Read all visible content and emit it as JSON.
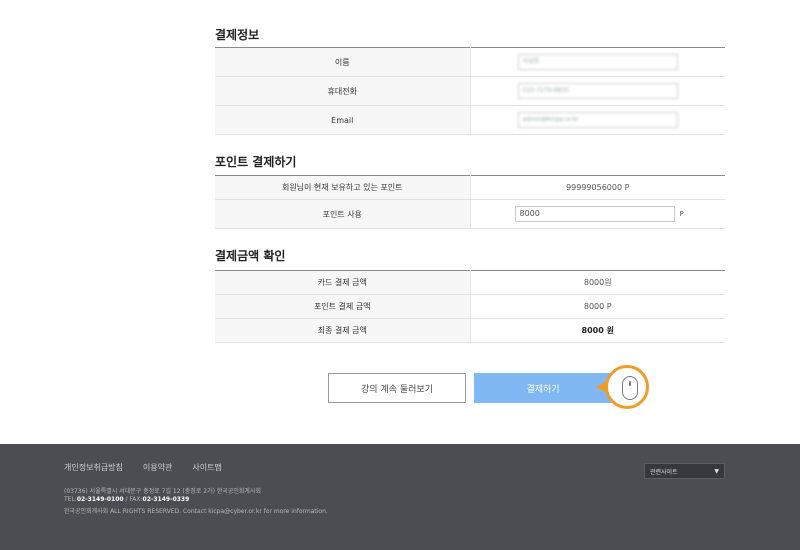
{
  "payment_info": {
    "title": "결제정보",
    "rows": [
      {
        "label": "이름",
        "value": "이성현"
      },
      {
        "label": "휴대전화",
        "value": "010-7270-9835"
      },
      {
        "label": "Email",
        "value": "admin@kicpa.or.kr"
      }
    ]
  },
  "point_payment": {
    "title": "포인트 결제하기",
    "owned_label": "회원님이 현재 보유하고 있는 포인트",
    "owned_value": "99999056000 P",
    "use_label": "포인트 사용",
    "use_value": "8000",
    "use_unit": "P"
  },
  "amount_confirm": {
    "title": "결제금액 확인",
    "rows": [
      {
        "label": "카드 결제 금액",
        "value": "8000원"
      },
      {
        "label": "포인트 결제 금액",
        "value": "8000 P"
      },
      {
        "label": "최종 결제 금액",
        "value": "8000 원"
      }
    ]
  },
  "buttons": {
    "back": "강의 계속 둘러보기",
    "pay": "결제하기"
  },
  "footer": {
    "links": [
      "개인정보취급방침",
      "이용약관",
      "사이트맵"
    ],
    "address": "(03736) 서울특별시 서대문구 충정로 7길 12 (충정로 2가) 한국공인회계사회",
    "tel_label": "TEL:",
    "tel": "02-3149-0100",
    "fax_label": " / FAX:",
    "fax": "02-3149-0339",
    "copyright": "한국공인회계사회 ALL RIGHTS RESERVED. Contact kicpa@cyber.or.kr for more information.",
    "related_label": "관련사이트",
    "related_arrow": "▼"
  },
  "colors": {
    "pay_button": "#7fb8f2",
    "cursor_highlight": "#ef9d2a",
    "footer_bg": "#4a4d52"
  }
}
